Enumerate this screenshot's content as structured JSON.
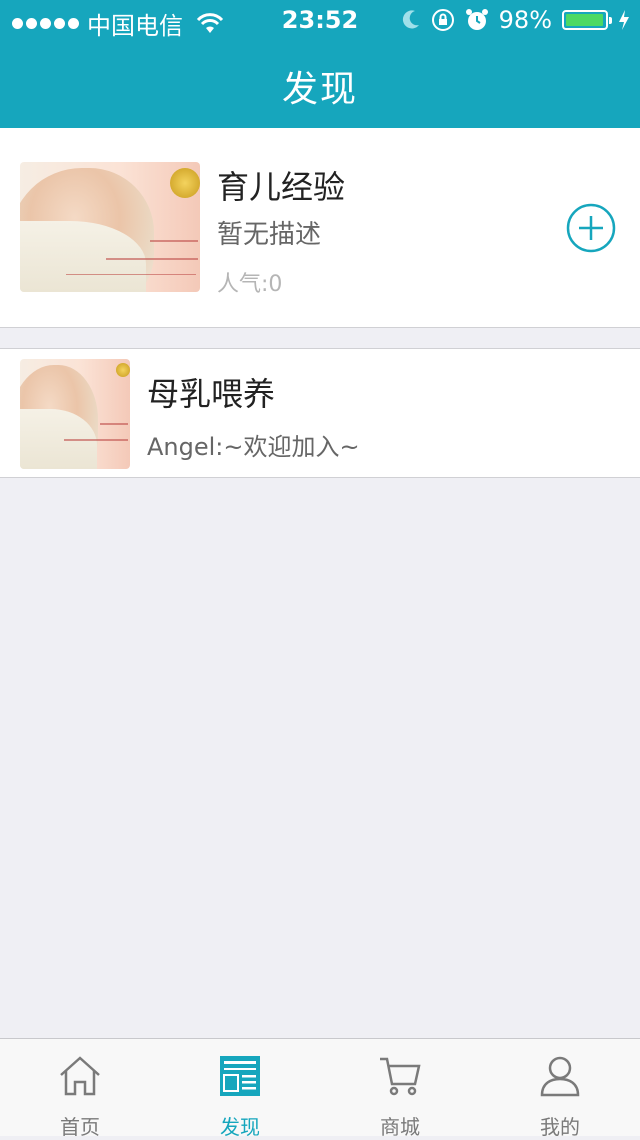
{
  "status_bar": {
    "carrier": "中国电信",
    "time": "23:52",
    "battery": "98%",
    "battery_level": 0.98
  },
  "nav": {
    "title": "发现"
  },
  "cards": [
    {
      "title": "育儿经验",
      "description": "暂无描述",
      "popularity": "人气:0"
    },
    {
      "title": "母乳喂养",
      "message": "Angel:~欢迎加入~"
    }
  ],
  "tabs": [
    {
      "label": "首页",
      "icon": "home-icon"
    },
    {
      "label": "发现",
      "icon": "discover-icon"
    },
    {
      "label": "商城",
      "icon": "cart-icon"
    },
    {
      "label": "我的",
      "icon": "user-icon"
    }
  ],
  "colors": {
    "brand": "#16a6bd",
    "battery": "#4cd964"
  }
}
